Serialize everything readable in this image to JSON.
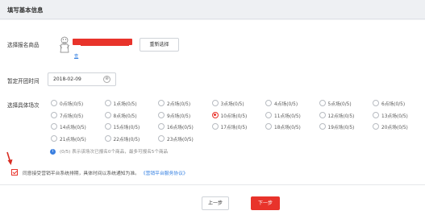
{
  "header": {
    "title": "填写基本信息"
  },
  "product": {
    "label": "选择报名商品",
    "link_text": "查",
    "reselect_label": "重新选择"
  },
  "start_time": {
    "label": "暂定开团时间",
    "value": "2018-02-09",
    "clear_glyph": "⊗"
  },
  "sessions": {
    "label": "选择具体场次",
    "selected_index": 10,
    "options": [
      "0点场(0/5)",
      "1点场(0/5)",
      "2点场(0/5)",
      "3点场(0/5)",
      "4点场(0/5)",
      "5点场(0/5)",
      "6点场(0/5)",
      "7点场(0/5)",
      "8点场(0/5)",
      "9点场(0/5)",
      "10点场(0/5)",
      "11点场(0/5)",
      "12点场(0/5)",
      "13点场(0/5)",
      "14点场(0/5)",
      "15点场(0/5)",
      "16点场(0/5)",
      "17点场(0/5)",
      "18点场(0/5)",
      "19点场(0/5)",
      "20点场(0/5)",
      "21点场(0/5)",
      "22点场(0/5)",
      "23点场(0/5)"
    ]
  },
  "info": {
    "icon_glyph": "i",
    "text": "(0/5) 表示该场次已报名0个商品，最多可报名5个商品"
  },
  "agreement": {
    "text": "同意接受营销平台系统排期，具体时间以系统通知为准。",
    "link": "《营销平台服务协议》"
  },
  "footer": {
    "prev_label": "上一步",
    "next_label": "下一步"
  },
  "colors": {
    "accent": "#e8332b",
    "link": "#2f7de1"
  }
}
